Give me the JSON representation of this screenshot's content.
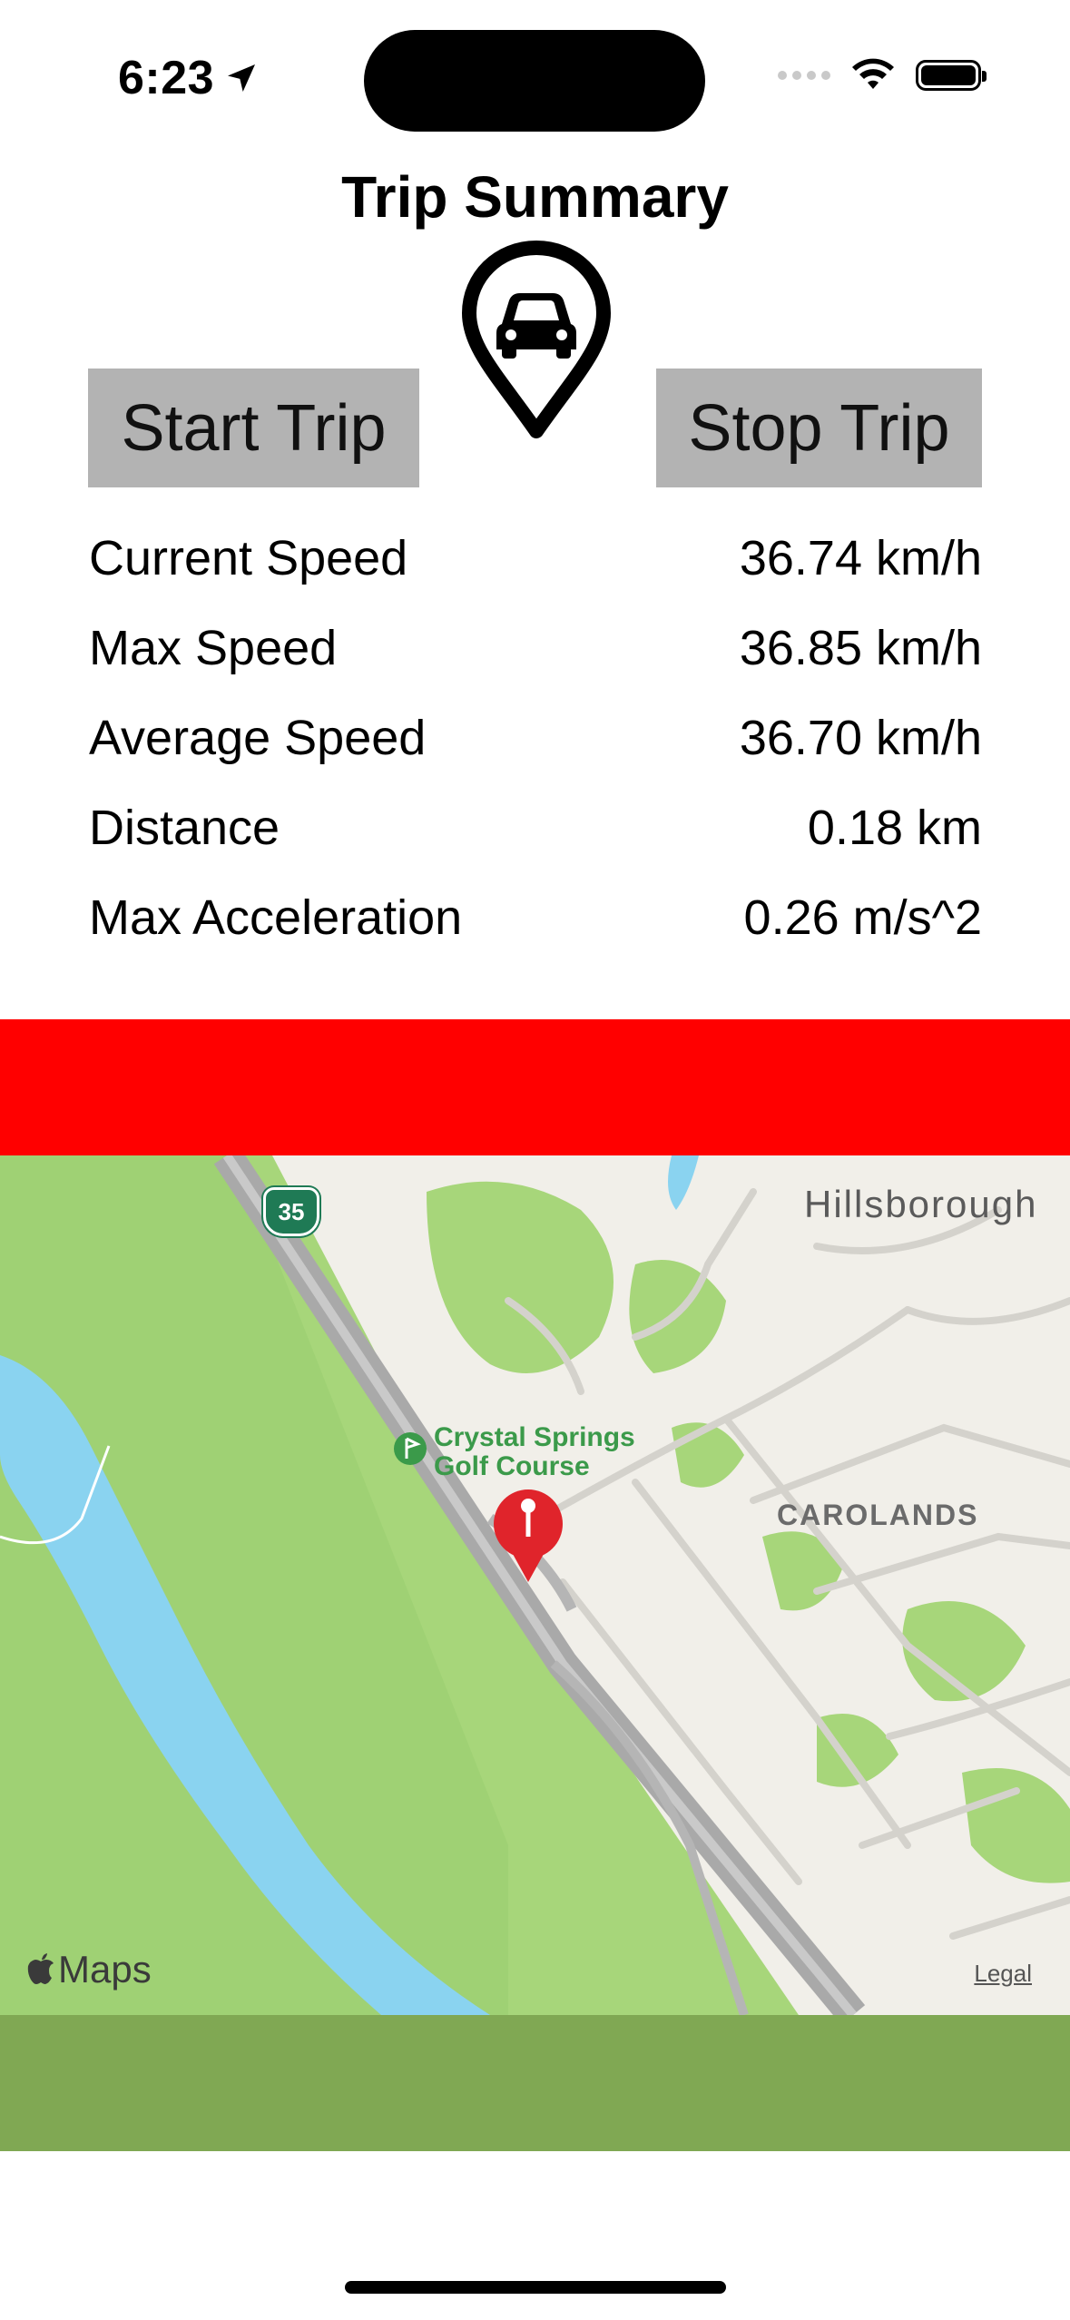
{
  "status_bar": {
    "time": "6:23",
    "icons": [
      "location-arrow-icon",
      "cellular-signal-icon",
      "wifi-icon",
      "battery-icon"
    ]
  },
  "header": {
    "title": "Trip Summary",
    "icon": "car-location-pin-icon"
  },
  "controls": {
    "start_label": "Start Trip",
    "stop_label": "Stop Trip"
  },
  "stats": [
    {
      "label": "Current Speed",
      "value": "36.74 km/h"
    },
    {
      "label": "Max Speed",
      "value": "36.85 km/h"
    },
    {
      "label": "Average Speed",
      "value": "36.70 km/h"
    },
    {
      "label": "Distance",
      "value": "0.18 km"
    },
    {
      "label": "Max Acceleration",
      "value": "0.26 m/s^2"
    }
  ],
  "bands": {
    "top_color": "#ff0000",
    "bottom_color": "#80a853"
  },
  "map": {
    "labels": {
      "town": "Hillsborough",
      "neighborhood": "CAROLANDS",
      "golf_line1": "Crystal Springs",
      "golf_line2": "Golf Course",
      "route": "35"
    },
    "attribution": "Maps",
    "legal": "Legal",
    "pin_color": "#e0242b"
  }
}
